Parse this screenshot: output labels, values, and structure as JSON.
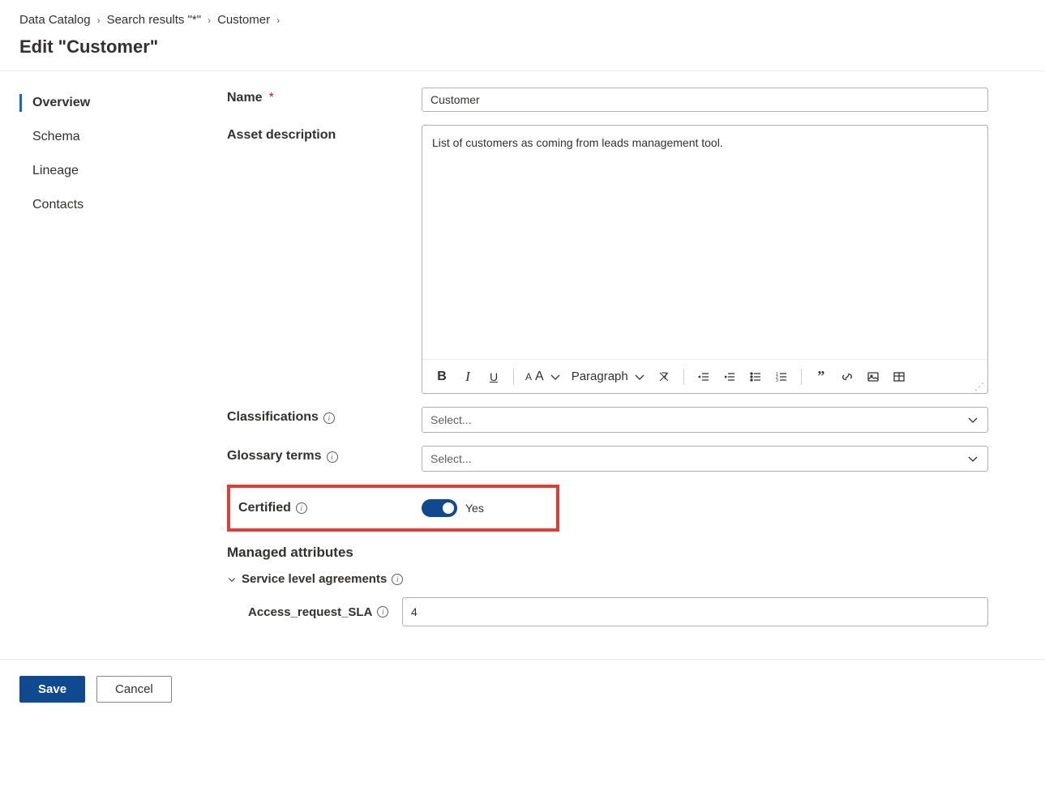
{
  "breadcrumb": {
    "items": [
      "Data Catalog",
      "Search results \"*\"",
      "Customer"
    ]
  },
  "page_title": "Edit \"Customer\"",
  "sidebar": {
    "items": [
      {
        "label": "Overview",
        "active": true
      },
      {
        "label": "Schema",
        "active": false
      },
      {
        "label": "Lineage",
        "active": false
      },
      {
        "label": "Contacts",
        "active": false
      }
    ]
  },
  "form": {
    "name": {
      "label": "Name",
      "required": true,
      "value": "Customer"
    },
    "description": {
      "label": "Asset description",
      "value": "List of customers as coming from leads management tool."
    },
    "classifications": {
      "label": "Classifications",
      "placeholder": "Select..."
    },
    "glossary": {
      "label": "Glossary terms",
      "placeholder": "Select..."
    },
    "certified": {
      "label": "Certified",
      "value": "Yes",
      "on": true
    },
    "managed_attributes": {
      "label": "Managed attributes"
    },
    "sla_group": {
      "label": "Service level agreements"
    },
    "access_sla": {
      "label": "Access_request_SLA",
      "value": "4"
    }
  },
  "toolbar": {
    "paragraph_label": "Paragraph"
  },
  "footer": {
    "save": "Save",
    "cancel": "Cancel"
  }
}
